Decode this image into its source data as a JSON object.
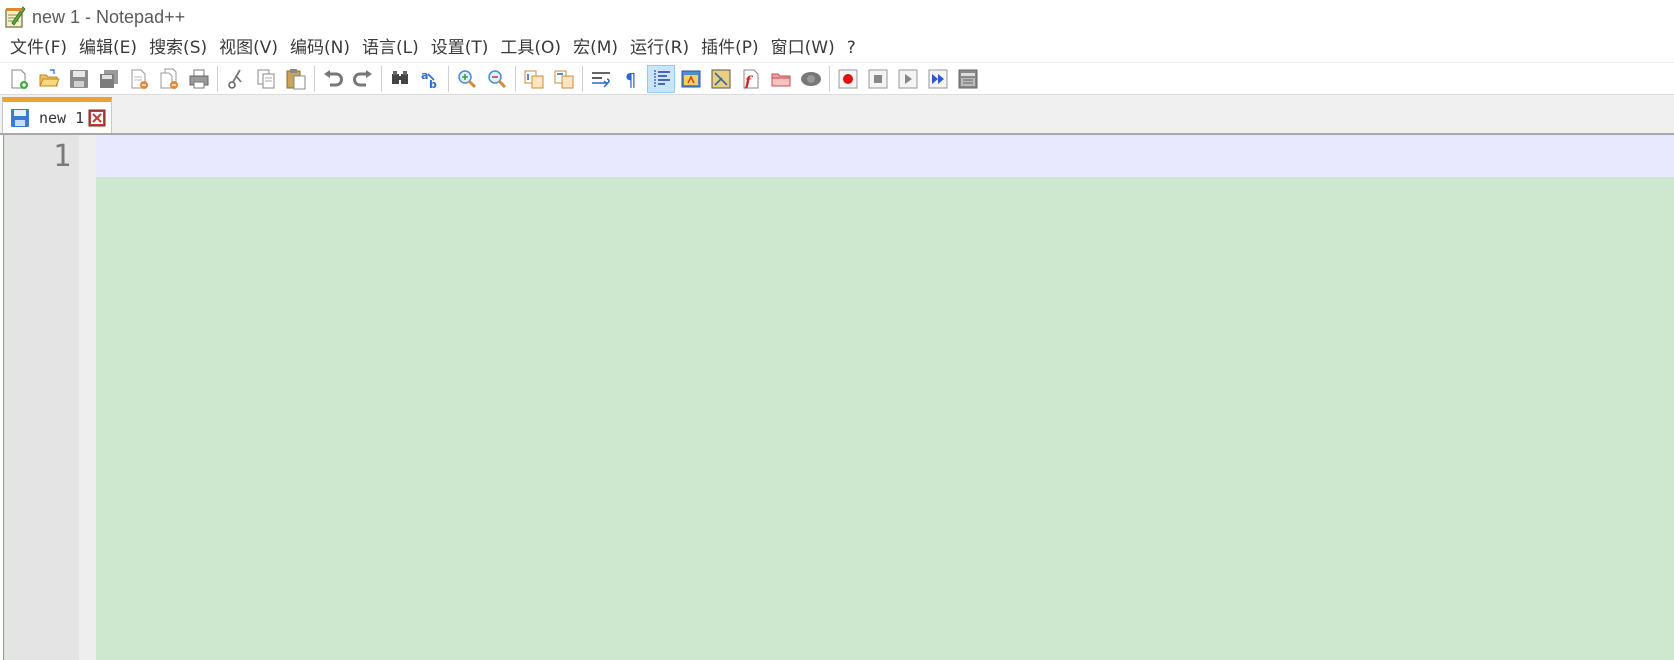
{
  "window": {
    "title": "new 1 - Notepad++",
    "icon": "notepad-plus-plus-icon"
  },
  "menu": {
    "items": [
      {
        "label": "文件(F)"
      },
      {
        "label": "编辑(E)"
      },
      {
        "label": "搜索(S)"
      },
      {
        "label": "视图(V)"
      },
      {
        "label": "编码(N)"
      },
      {
        "label": "语言(L)"
      },
      {
        "label": "设置(T)"
      },
      {
        "label": "工具(O)"
      },
      {
        "label": "宏(M)"
      },
      {
        "label": "运行(R)"
      },
      {
        "label": "插件(P)"
      },
      {
        "label": "窗口(W)"
      },
      {
        "label": "?"
      }
    ]
  },
  "toolbar": {
    "icons": [
      "new-file-icon",
      "open-file-icon",
      "save-icon",
      "save-all-icon",
      "close-icon",
      "close-all-icon",
      "print-icon",
      "cut-icon",
      "copy-icon",
      "paste-icon",
      "undo-icon",
      "redo-icon",
      "find-icon",
      "replace-icon",
      "zoom-in-icon",
      "zoom-out-icon",
      "sync-vertical-icon",
      "sync-horizontal-icon",
      "word-wrap-icon",
      "show-all-chars-icon",
      "indent-guide-icon",
      "lang-panel-icon",
      "doc-map-icon",
      "function-list-icon",
      "folder-workspace-icon",
      "monitoring-icon",
      "record-macro-icon",
      "stop-record-icon",
      "play-macro-icon",
      "run-macro-multiple-icon",
      "save-macro-icon"
    ],
    "active": "indent-guide-icon"
  },
  "tabs": [
    {
      "label": "new 1",
      "active": true
    }
  ],
  "editor": {
    "line_numbers": [
      "1"
    ],
    "colors": {
      "background": "#cde8cf",
      "current_line": "#e8e8ff",
      "gutter": "#e4e4e4"
    }
  }
}
